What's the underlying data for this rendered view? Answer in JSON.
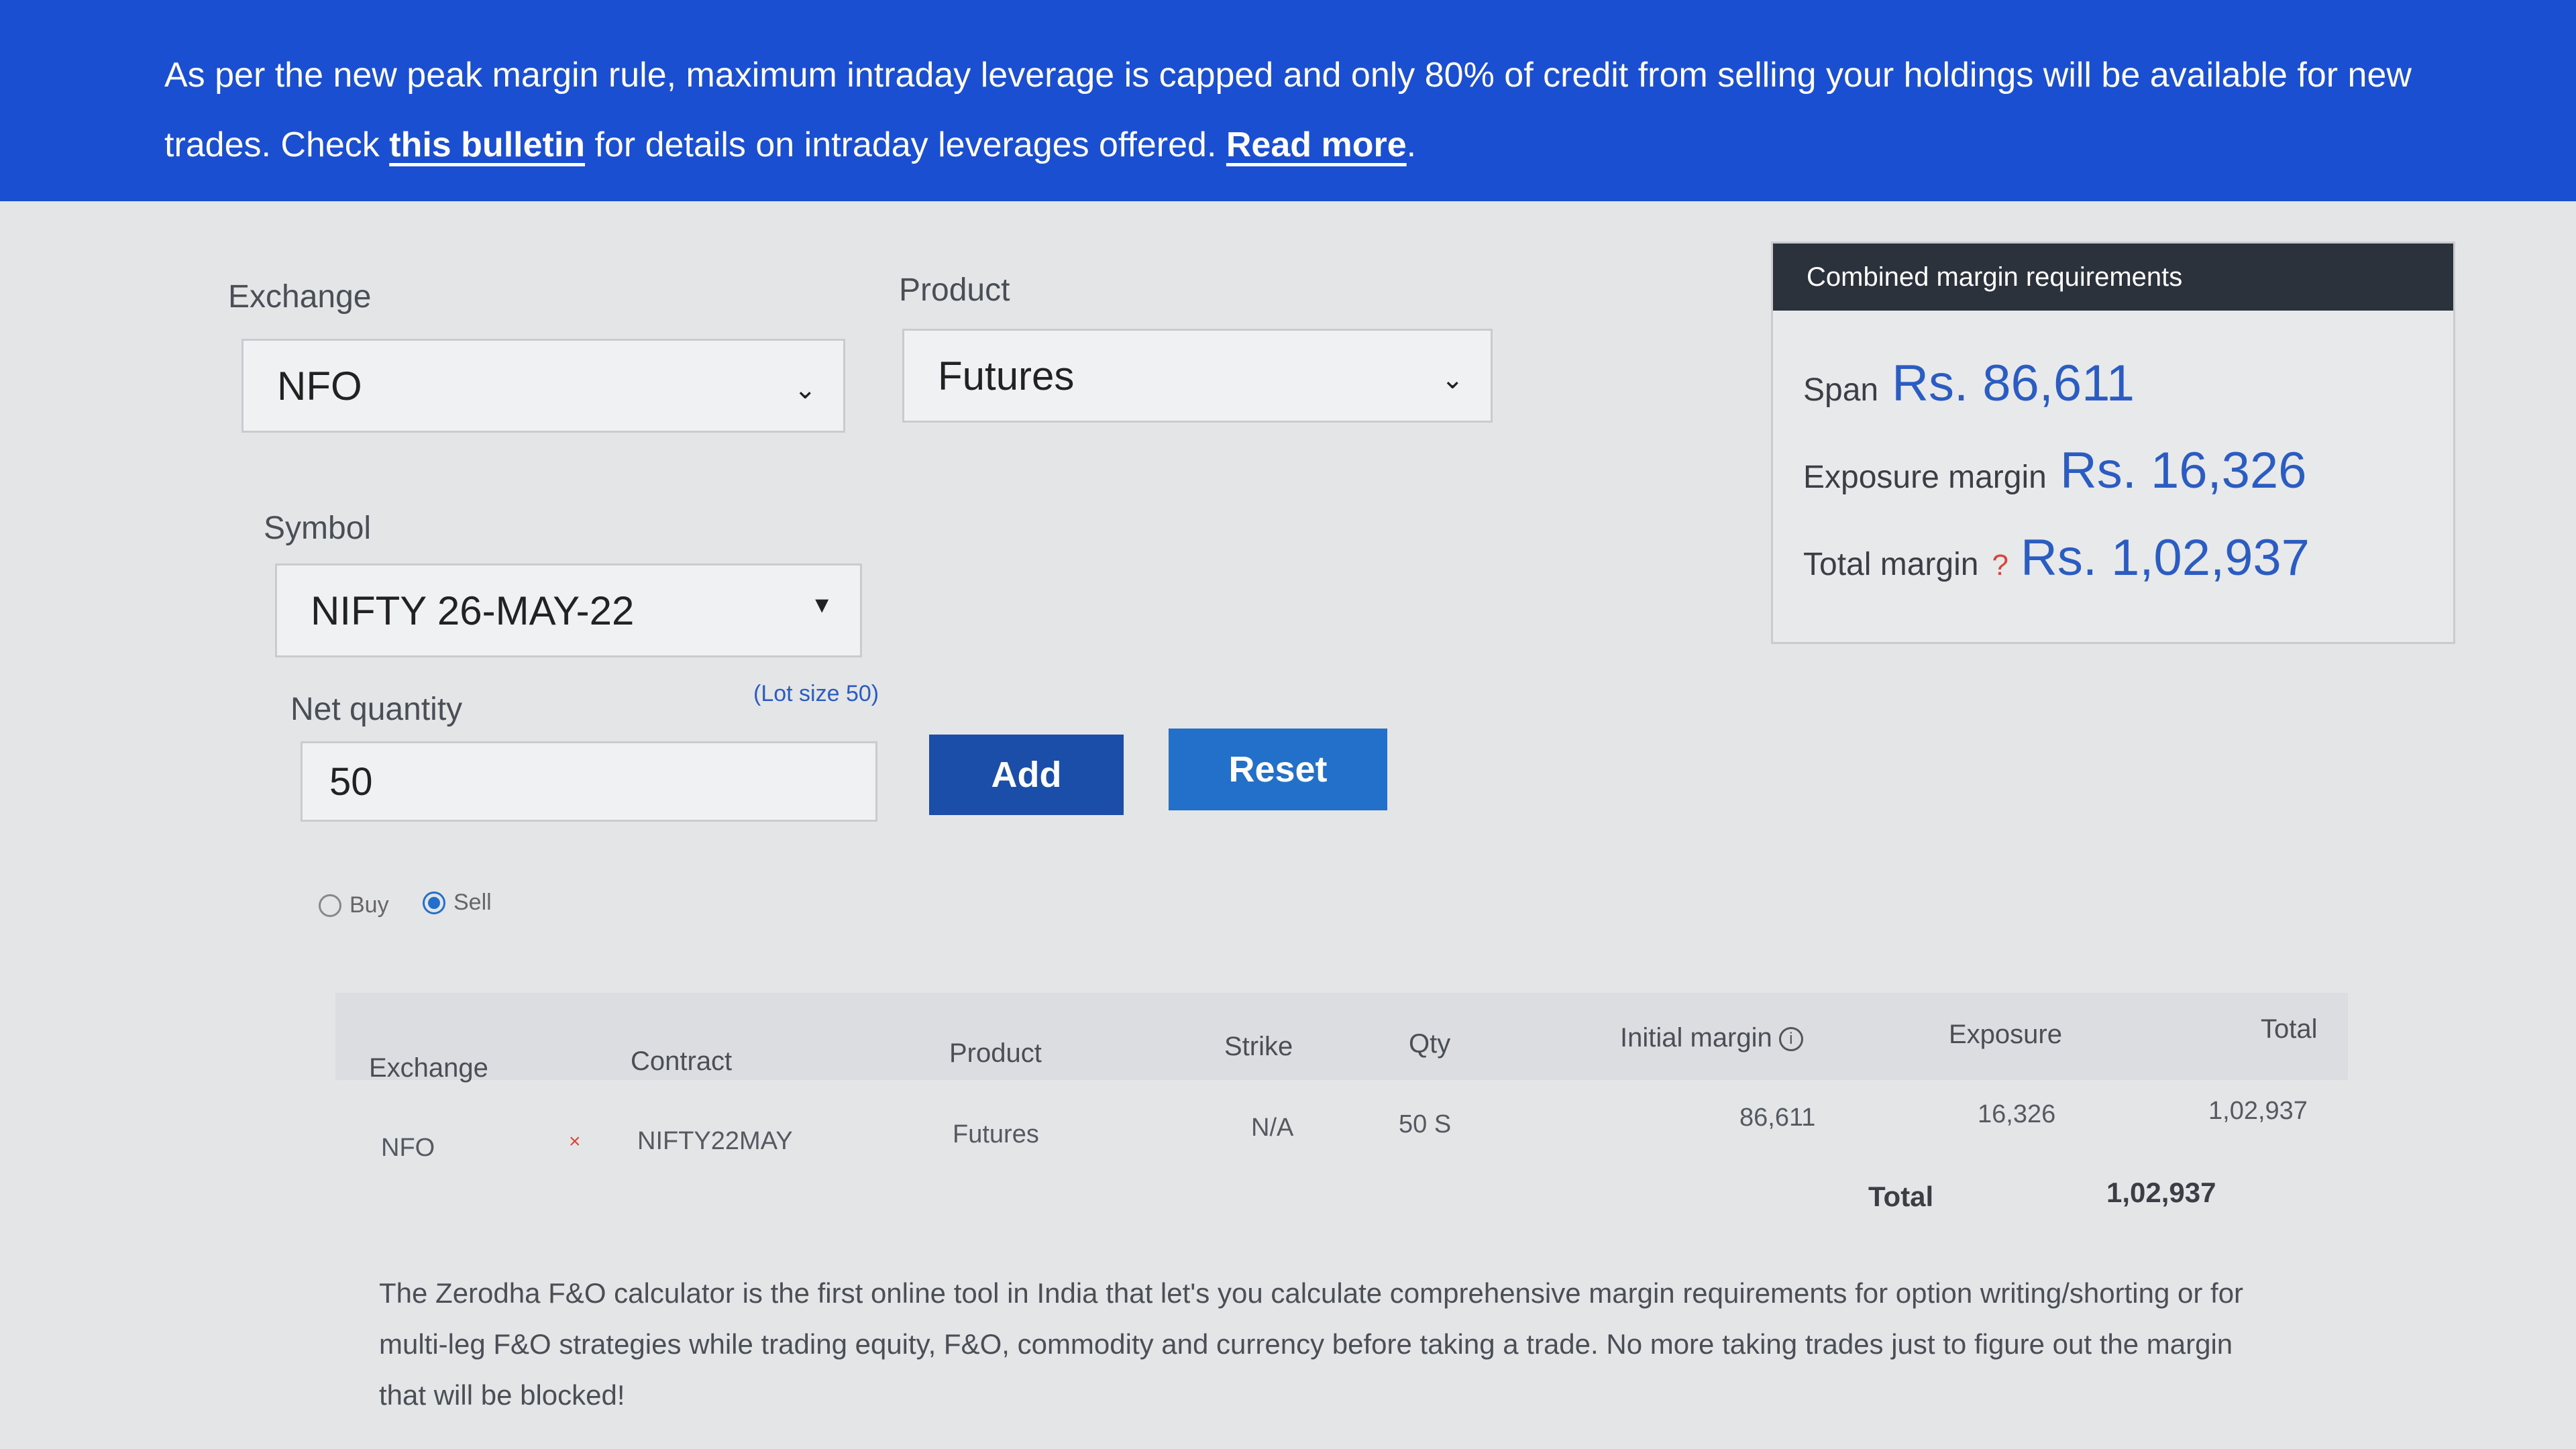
{
  "banner": {
    "text_1": "As per the new peak margin rule, maximum intraday leverage is capped and only 80% of credit from selling your holdings will be available for new trades. Check ",
    "link_bulletin": "this bulletin",
    "text_2": " for details on intraday leverages offered. ",
    "link_read_more": "Read more",
    "text_3": "."
  },
  "form": {
    "exchange_label": "Exchange",
    "exchange_value": "NFO",
    "product_label": "Product",
    "product_value": "Futures",
    "symbol_label": "Symbol",
    "symbol_value": "NIFTY 26-MAY-22",
    "qty_label": "Net quantity",
    "lot_size": "(Lot size 50)",
    "qty_value": "50",
    "add_label": "Add",
    "reset_label": "Reset",
    "radio_buy": "Buy",
    "radio_sell": "Sell",
    "selected_side": "Sell"
  },
  "summary": {
    "title": "Combined margin requirements",
    "span_label": "Span",
    "span_value": "Rs. 86,611",
    "exposure_label": "Exposure margin",
    "exposure_value": "Rs. 16,326",
    "total_label": "Total margin",
    "total_help": "?",
    "total_value": "Rs. 1,02,937"
  },
  "table": {
    "headers": [
      "Exchange",
      "Contract",
      "Product",
      "Strike",
      "Qty",
      "Initial margin",
      "Exposure",
      "Total"
    ],
    "rows": [
      [
        "NFO",
        "NIFTY22MAY",
        "Futures",
        "N/A",
        "50 S",
        "86,611",
        "16,326",
        "1,02,937"
      ]
    ],
    "remove_glyph": "×",
    "total_label": "Total",
    "total_value": "1,02,937"
  },
  "description": "The Zerodha F&O calculator is the first online tool in India that let's you calculate comprehensive margin requirements for option writing/shorting or for multi-leg F&O strategies while trading equity, F&O, commodity and currency before taking a trade. No more taking trades just to figure out the margin that will be blocked!",
  "colors": {
    "banner": "#1b4fd1",
    "add_button": "#1a4ea8",
    "reset_button": "#2270c9",
    "value_blue": "#2a5cc2",
    "help_red": "#d9453a"
  }
}
